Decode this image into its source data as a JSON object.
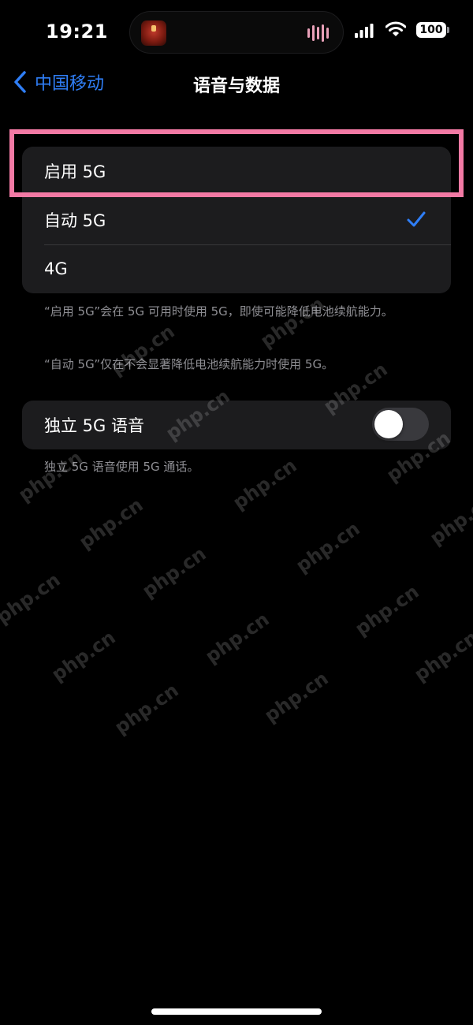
{
  "status_bar": {
    "time": "19:21",
    "battery": "100",
    "icons": [
      "signal-icon",
      "wifi-icon",
      "battery-icon"
    ]
  },
  "nav": {
    "back_label": "中国移动",
    "title": "语音与数据"
  },
  "network_options": [
    {
      "label": "启用 5G",
      "selected": false
    },
    {
      "label": "自动 5G",
      "selected": true
    },
    {
      "label": "4G",
      "selected": false
    }
  ],
  "notes": {
    "enable_5g": "“启用 5G”会在 5G 可用时使用 5G，即使可能降低电池续航能力。",
    "auto_5g": "“自动 5G”仅在不会显著降低电池续航能力时使用 5G。"
  },
  "sa_voice": {
    "label": "独立 5G 语音",
    "enabled": false,
    "note": "独立 5G 语音使用 5G 通话。"
  },
  "watermark": "php.cn",
  "colors": {
    "accent": "#2f7ef6",
    "highlight": "#f37aa5",
    "group_bg": "#1c1c1e"
  }
}
